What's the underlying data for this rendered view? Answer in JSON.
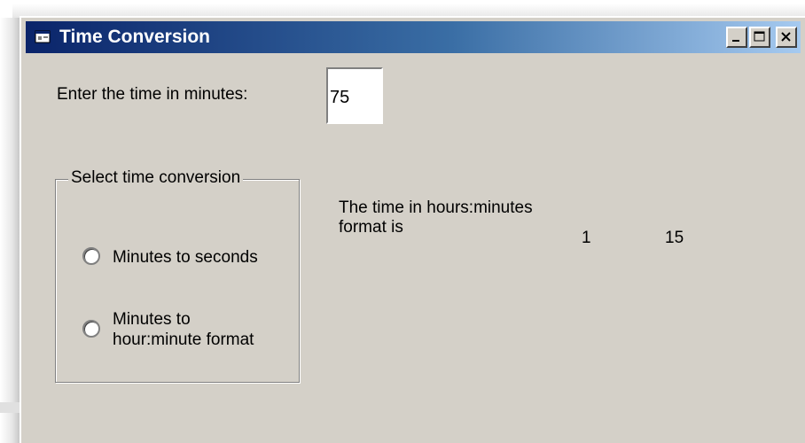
{
  "window": {
    "title": "Time Conversion",
    "icon": "form-icon"
  },
  "input": {
    "label": "Enter the time in minutes:",
    "value": "75"
  },
  "conversion_group": {
    "legend": "Select time conversion",
    "options": [
      {
        "label": "Minutes to seconds",
        "selected": false
      },
      {
        "label": "Minutes to hour:minute format",
        "selected": false
      }
    ]
  },
  "result": {
    "label": "The time in hours:minutes format is",
    "hours": "1",
    "minutes": "15"
  }
}
